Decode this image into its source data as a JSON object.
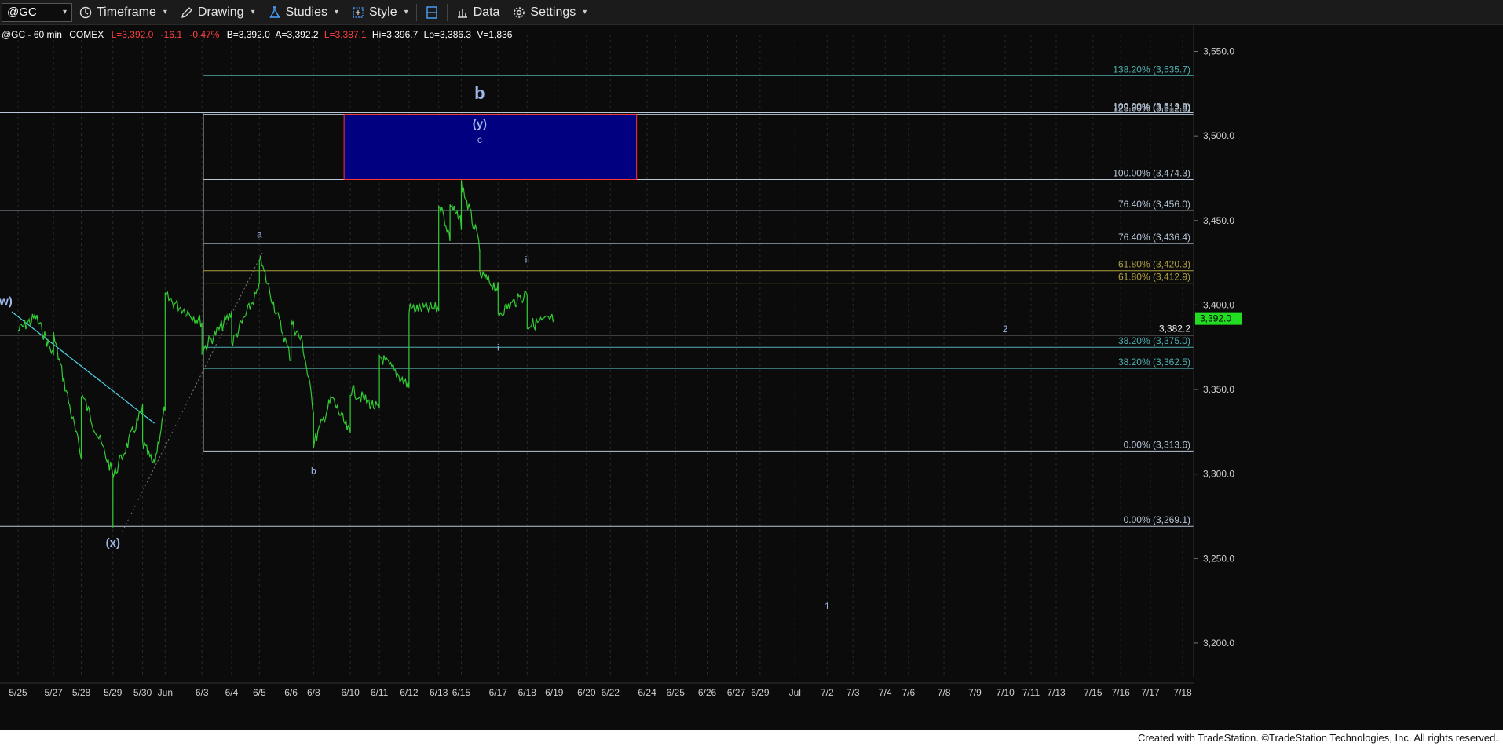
{
  "toolbar": {
    "symbol": "@GC",
    "timeframe_label": "Timeframe",
    "drawing_label": "Drawing",
    "studies_label": "Studies",
    "style_label": "Style",
    "data_label": "Data",
    "settings_label": "Settings",
    "icons": [
      "clock-icon",
      "pencil-icon",
      "flask-icon",
      "layout-icon",
      "columns-icon",
      "bar-chart-icon",
      "gear-icon"
    ]
  },
  "header": {
    "symbol_info": "@GC - 60 min",
    "exchange": "COMEX",
    "last": "L=3,392.0",
    "change": "-16.1",
    "change_pct": "-0.47%",
    "bid": "B=3,392.0",
    "ask": "A=3,392.2",
    "low_last": "L=3,387.1",
    "hi": "Hi=3,396.7",
    "lo": "Lo=3,386.3",
    "volume": "V=1,836"
  },
  "colors": {
    "background": "#0b0b0c",
    "price_line": "#33cc33",
    "fib_teal": "#4fb0b0",
    "fib_gold": "#b0a040",
    "horizontal": "#b7c7d8",
    "box_fill": "#000080",
    "box_border": "#ff3333",
    "label_blue": "#9fb8e8",
    "negative": "#ff4040"
  },
  "chart_data": {
    "type": "line",
    "title": "",
    "ylim": [
      3180,
      3560
    ],
    "y_ticks": [
      3200,
      3250,
      3300,
      3350,
      3400,
      3450,
      3500,
      3550
    ],
    "y_tick_labels": [
      "3,200.0",
      "3,250.0",
      "3,300.0",
      "3,350.0",
      "3,400.0",
      "3,450.0",
      "3,500.0",
      "3,550.0"
    ],
    "x_tick_labels": [
      "5/25",
      "5/27",
      "5/28",
      "5/29",
      "5/30",
      "Jun",
      "6/3",
      "6/4",
      "6/5",
      "6/6",
      "6/8",
      "6/10",
      "6/11",
      "6/12",
      "6/13",
      "6/15",
      "6/17",
      "6/18",
      "6/19",
      "6/20",
      "6/22",
      "6/24",
      "6/25",
      "6/26",
      "6/27",
      "6/29",
      "Jul",
      "7/2",
      "7/3",
      "7/4",
      "7/6",
      "7/8",
      "7/9",
      "7/10",
      "7/11",
      "7/13",
      "7/15",
      "7/16",
      "7/17",
      "7/18"
    ],
    "last_price": 3392.0,
    "last_price_label": "3,392.0",
    "series": [
      {
        "name": "",
        "points": [
          [
            "5/25",
            3385
          ],
          [
            "5/26",
            3393
          ],
          [
            "5/27",
            3370
          ],
          [
            "5/27",
            3382
          ],
          [
            "5/28",
            3310
          ],
          [
            "5/28",
            3328
          ],
          [
            "5/28",
            3348
          ],
          [
            "5/29",
            3300
          ],
          [
            "5/29",
            3272
          ],
          [
            "5/29",
            3298
          ],
          [
            "5/30",
            3338
          ],
          [
            "5/30",
            3318
          ],
          [
            "5/31",
            3305
          ],
          [
            "Jun",
            3340
          ],
          [
            "Jun",
            3405
          ],
          [
            "6/3",
            3390
          ],
          [
            "6/3",
            3373
          ],
          [
            "6/4",
            3395
          ],
          [
            "6/4",
            3377
          ],
          [
            "6/5",
            3410
          ],
          [
            "6/5",
            3428
          ],
          [
            "6/6",
            3368
          ],
          [
            "6/6",
            3390
          ],
          [
            "6/7",
            3378
          ],
          [
            "6/8",
            3338
          ],
          [
            "6/8",
            3318
          ],
          [
            "6/9",
            3345
          ],
          [
            "6/10",
            3323
          ],
          [
            "6/10",
            3350
          ],
          [
            "6/11",
            3338
          ],
          [
            "6/11",
            3370
          ],
          [
            "6/12",
            3352
          ],
          [
            "6/12",
            3398
          ],
          [
            "6/13",
            3398
          ],
          [
            "6/13",
            3462
          ],
          [
            "6/14",
            3440
          ],
          [
            "6/14",
            3460
          ],
          [
            "6/15",
            3448
          ],
          [
            "6/15",
            3472
          ],
          [
            "6/16",
            3435
          ],
          [
            "6/16",
            3418
          ],
          [
            "6/17",
            3410
          ],
          [
            "6/17",
            3395
          ],
          [
            "6/18",
            3407
          ],
          [
            "6/18",
            3402
          ],
          [
            "6/18",
            3388
          ],
          [
            "6/19",
            3392
          ]
        ]
      }
    ],
    "fib_levels": [
      {
        "label": "138.20% (3,535.7)",
        "value": 3535.7,
        "color": "teal"
      },
      {
        "label": "123.60% (3,512.8)",
        "value": 3512.8,
        "color": "white"
      },
      {
        "label": "100.00% (3,513.8)",
        "value": 3513.8,
        "color": "white"
      },
      {
        "label": "100.00% (3,474.3)",
        "value": 3474.3,
        "color": "white"
      },
      {
        "label": "76.40% (3,456.0)",
        "value": 3456.0,
        "color": "white"
      },
      {
        "label": "76.40% (3,436.4)",
        "value": 3436.4,
        "color": "white"
      },
      {
        "label": "61.80% (3,420.3)",
        "value": 3420.3,
        "color": "gold"
      },
      {
        "label": "61.80% (3,412.9)",
        "value": 3412.9,
        "color": "gold"
      },
      {
        "label": "38.20% (3,375.0)",
        "value": 3375.0,
        "color": "teal"
      },
      {
        "label": "38.20% (3,362.5)",
        "value": 3362.5,
        "color": "teal"
      },
      {
        "label": "0.00% (3,313.6)",
        "value": 3313.6,
        "color": "white"
      },
      {
        "label": "0.00% (3,269.1)",
        "value": 3269.1,
        "color": "white"
      }
    ],
    "horizontal_line": {
      "value": 3382.2,
      "label": "3,382.2"
    },
    "target_box": {
      "x_from": "6/10",
      "x_to": "6/23",
      "y_from": 3474.3,
      "y_to": 3512.8
    },
    "wave_labels": [
      {
        "text": "(w)",
        "x": "5/24",
        "y": 3400
      },
      {
        "text": "(x)",
        "x": "5/29",
        "y": 3257
      },
      {
        "text": "a",
        "x": "6/5",
        "y": 3440
      },
      {
        "text": "b",
        "x": "6/8",
        "y": 3300
      },
      {
        "text": "b",
        "x": "6/16",
        "y": 3522
      },
      {
        "text": "(y)",
        "x": "6/16",
        "y": 3505
      },
      {
        "text": "c",
        "x": "6/16",
        "y": 3496
      },
      {
        "text": "ii",
        "x": "6/18",
        "y": 3425
      },
      {
        "text": "i",
        "x": "6/17",
        "y": 3373
      },
      {
        "text": "2",
        "x": "7/10",
        "y": 3384
      },
      {
        "text": "1",
        "x": "7/2",
        "y": 3220
      }
    ]
  },
  "footer_text": "Created with TradeStation. ©TradeStation Technologies, Inc. All rights reserved."
}
